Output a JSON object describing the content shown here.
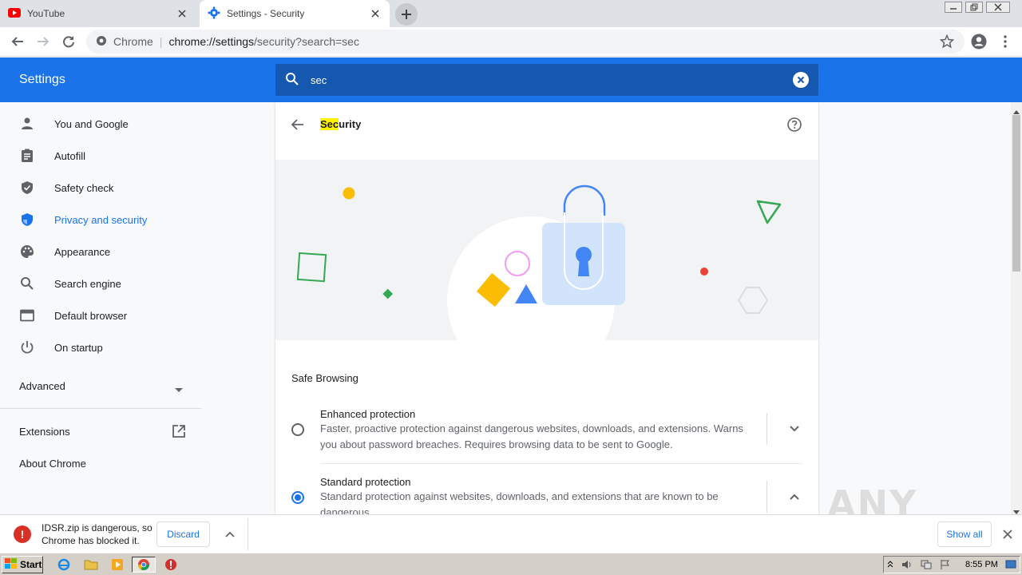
{
  "tabs": [
    {
      "title": "YouTube",
      "icon": "youtube-icon",
      "active": false
    },
    {
      "title": "Settings - Security",
      "icon": "gear-icon",
      "active": true
    }
  ],
  "omnibox": {
    "chip": "Chrome",
    "url_host": "chrome://settings",
    "url_path": "/security?search=sec"
  },
  "header": {
    "title": "Settings",
    "search_value": "sec"
  },
  "sidebar": {
    "items": [
      {
        "label": "You and Google",
        "icon": "person-icon"
      },
      {
        "label": "Autofill",
        "icon": "clipboard-icon"
      },
      {
        "label": "Safety check",
        "icon": "shield-check-icon"
      },
      {
        "label": "Privacy and security",
        "icon": "shield-icon",
        "selected": true
      },
      {
        "label": "Appearance",
        "icon": "palette-icon"
      },
      {
        "label": "Search engine",
        "icon": "search-icon"
      },
      {
        "label": "Default browser",
        "icon": "browser-icon"
      },
      {
        "label": "On startup",
        "icon": "power-icon"
      }
    ],
    "advanced": "Advanced",
    "extensions": "Extensions",
    "about": "About Chrome"
  },
  "page": {
    "title_highlight": "Sec",
    "title_rest": "urity",
    "section": "Safe Browsing",
    "options": [
      {
        "title": "Enhanced protection",
        "description": "Faster, proactive protection against dangerous websites, downloads, and extensions. Warns you about password breaches. Requires browsing data to be sent to Google.",
        "selected": false
      },
      {
        "title": "Standard protection",
        "description": "Standard protection against websites, downloads, and extensions that are known to be dangerous.",
        "selected": true
      }
    ]
  },
  "download": {
    "message": "IDSR.zip is dangerous, so Chrome has blocked it.",
    "discard": "Discard",
    "show_all": "Show all"
  },
  "taskbar": {
    "start": "Start",
    "clock": "8:55 PM"
  },
  "watermark": "ANY RUN",
  "colors": {
    "accent": "#1a73e8",
    "header_blue": "#1a73e8",
    "search_bg": "#1558b0",
    "danger": "#d93025",
    "highlight": "#fff200"
  }
}
